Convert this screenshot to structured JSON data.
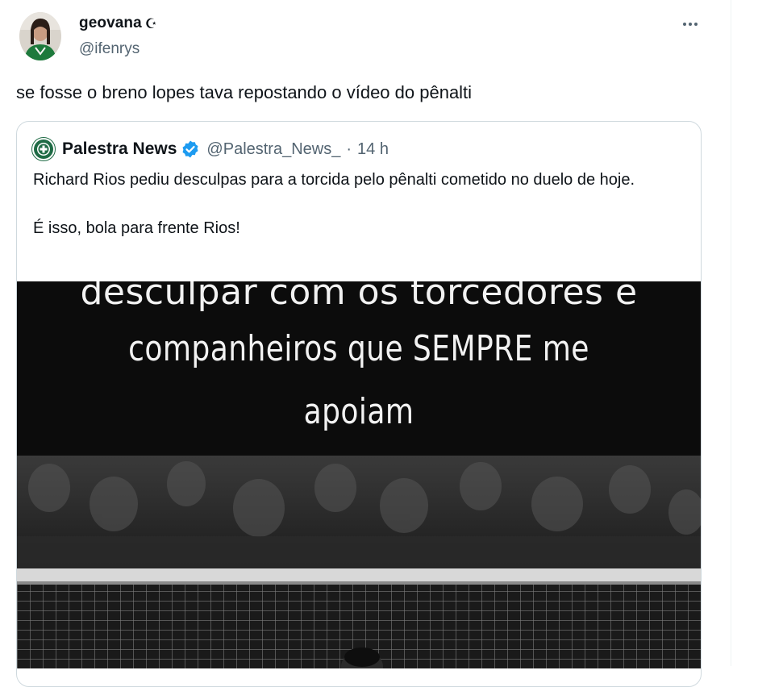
{
  "tweet": {
    "author_name": "geovana",
    "author_badge": "☪",
    "author_handle": "@ifenrys",
    "more_label": "More",
    "text": "se fosse o breno lopes tava repostando o vídeo do pênalti"
  },
  "quote": {
    "author_name": "Palestra News",
    "author_handle": "@Palestra_News_",
    "separator": "·",
    "time": "14 h",
    "paragraph_1": "Richard Rios pediu desculpas para a torcida pelo pênalti cometido no duelo de hoje.",
    "paragraph_2": "É isso, bola para frente Rios!",
    "media": {
      "caption_line_1": "desculpar com os torcedores e",
      "caption_line_2": "companheiros que SEMPRE  me",
      "caption_line_3": "apoiam"
    }
  },
  "icons": {
    "crescent": "crescent-icon",
    "verified": "verified-badge-icon",
    "more": "more-dots-icon"
  },
  "colors": {
    "text_primary": "#0f1419",
    "text_secondary": "#536471",
    "verified_blue": "#1d9bf0",
    "card_border": "#cfd9de",
    "palestra_green": "#1f6b45"
  }
}
